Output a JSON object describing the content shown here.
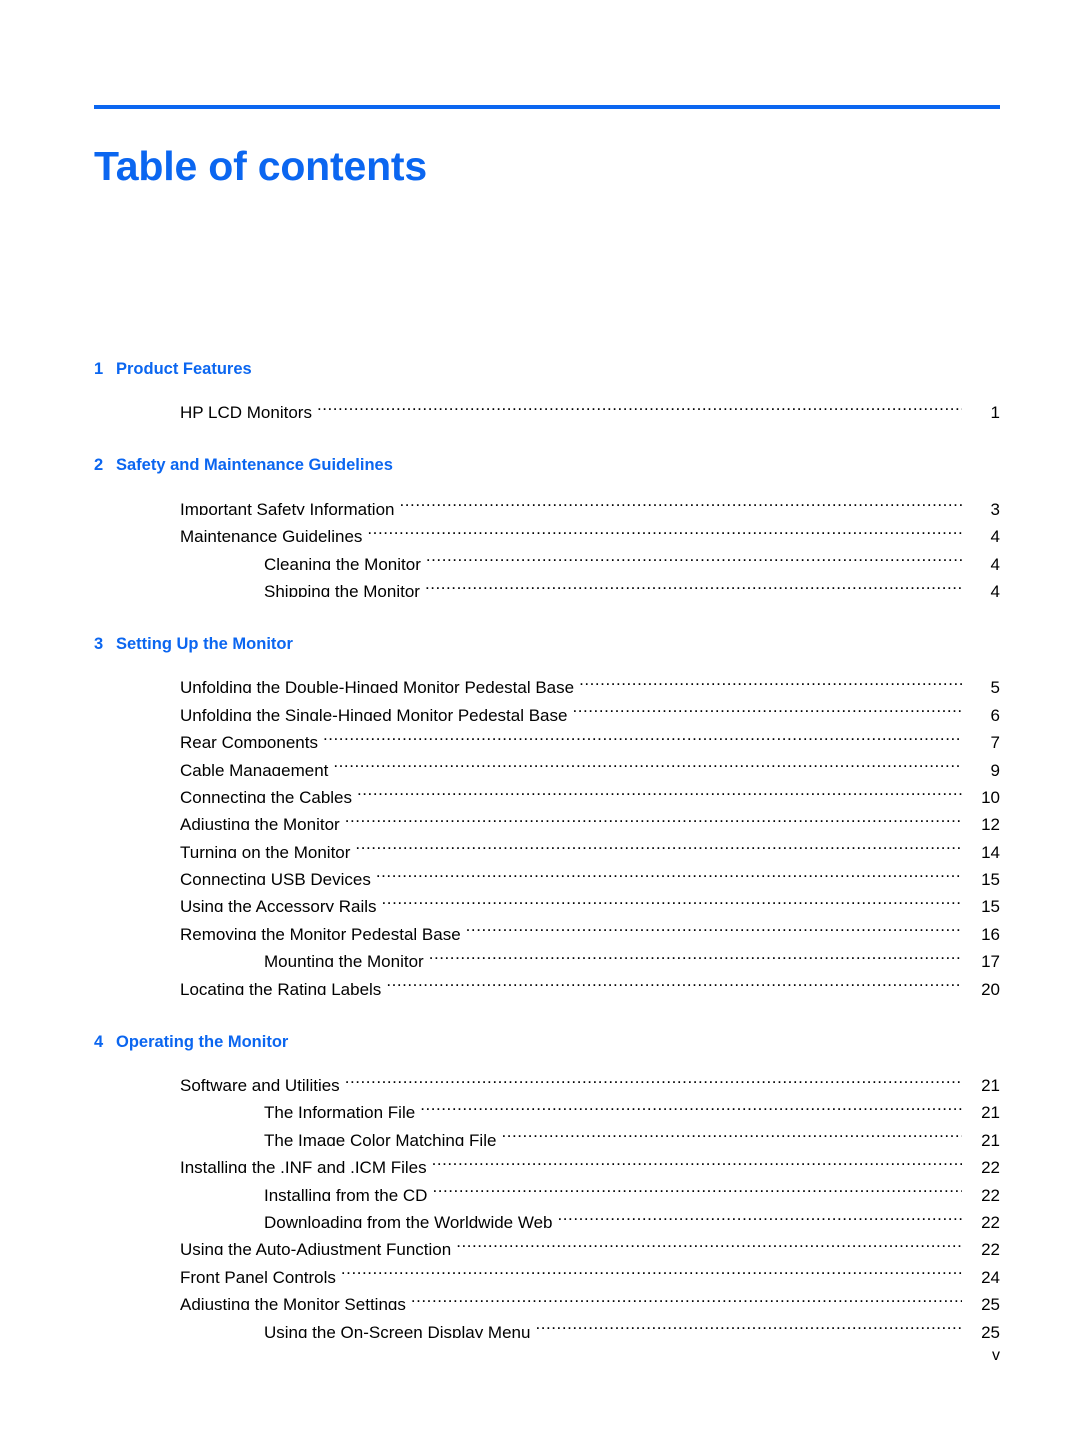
{
  "document": {
    "title": "Table of contents",
    "footer_page_number": "v",
    "accent_color": "#0b66f0",
    "text_color": "#000000"
  },
  "chapters": [
    {
      "number": "1",
      "title": "Product Features",
      "entries": [
        {
          "label": "HP LCD Monitors",
          "page": "1",
          "level": 1
        }
      ]
    },
    {
      "number": "2",
      "title": "Safety and Maintenance Guidelines",
      "entries": [
        {
          "label": "Important Safety Information",
          "page": "3",
          "level": 1
        },
        {
          "label": "Maintenance Guidelines",
          "page": "4",
          "level": 1
        },
        {
          "label": "Cleaning the Monitor",
          "page": "4",
          "level": 2
        },
        {
          "label": "Shipping the Monitor",
          "page": "4",
          "level": 2
        }
      ]
    },
    {
      "number": "3",
      "title": "Setting Up the Monitor",
      "entries": [
        {
          "label": "Unfolding the Double-Hinged Monitor Pedestal Base",
          "page": "5",
          "level": 1
        },
        {
          "label": "Unfolding the Single-Hinged Monitor Pedestal Base",
          "page": "6",
          "level": 1
        },
        {
          "label": "Rear Components",
          "page": "7",
          "level": 1
        },
        {
          "label": "Cable Management",
          "page": "9",
          "level": 1
        },
        {
          "label": "Connecting the Cables",
          "page": "10",
          "level": 1
        },
        {
          "label": "Adjusting the Monitor",
          "page": "12",
          "level": 1
        },
        {
          "label": "Turning on the Monitor",
          "page": "14",
          "level": 1
        },
        {
          "label": "Connecting USB Devices",
          "page": "15",
          "level": 1
        },
        {
          "label": "Using the Accessory Rails",
          "page": "15",
          "level": 1
        },
        {
          "label": "Removing the Monitor Pedestal Base",
          "page": "16",
          "level": 1
        },
        {
          "label": "Mounting the Monitor",
          "page": "17",
          "level": 2
        },
        {
          "label": "Locating the Rating Labels",
          "page": "20",
          "level": 1
        }
      ]
    },
    {
      "number": "4",
      "title": "Operating the Monitor",
      "entries": [
        {
          "label": "Software and Utilities",
          "page": "21",
          "level": 1
        },
        {
          "label": "The Information File",
          "page": "21",
          "level": 2
        },
        {
          "label": "The Image Color Matching File",
          "page": "21",
          "level": 2
        },
        {
          "label": "Installing the .INF and .ICM Files",
          "page": "22",
          "level": 1
        },
        {
          "label": "Installing from the CD",
          "page": "22",
          "level": 2
        },
        {
          "label": "Downloading from the Worldwide Web",
          "page": "22",
          "level": 2
        },
        {
          "label": "Using the Auto-Adjustment Function",
          "page": "22",
          "level": 1
        },
        {
          "label": "Front Panel Controls",
          "page": "24",
          "level": 1
        },
        {
          "label": "Adjusting the Monitor Settings",
          "page": "25",
          "level": 1
        },
        {
          "label": "Using the On-Screen Display Menu",
          "page": "25",
          "level": 2
        }
      ]
    }
  ]
}
